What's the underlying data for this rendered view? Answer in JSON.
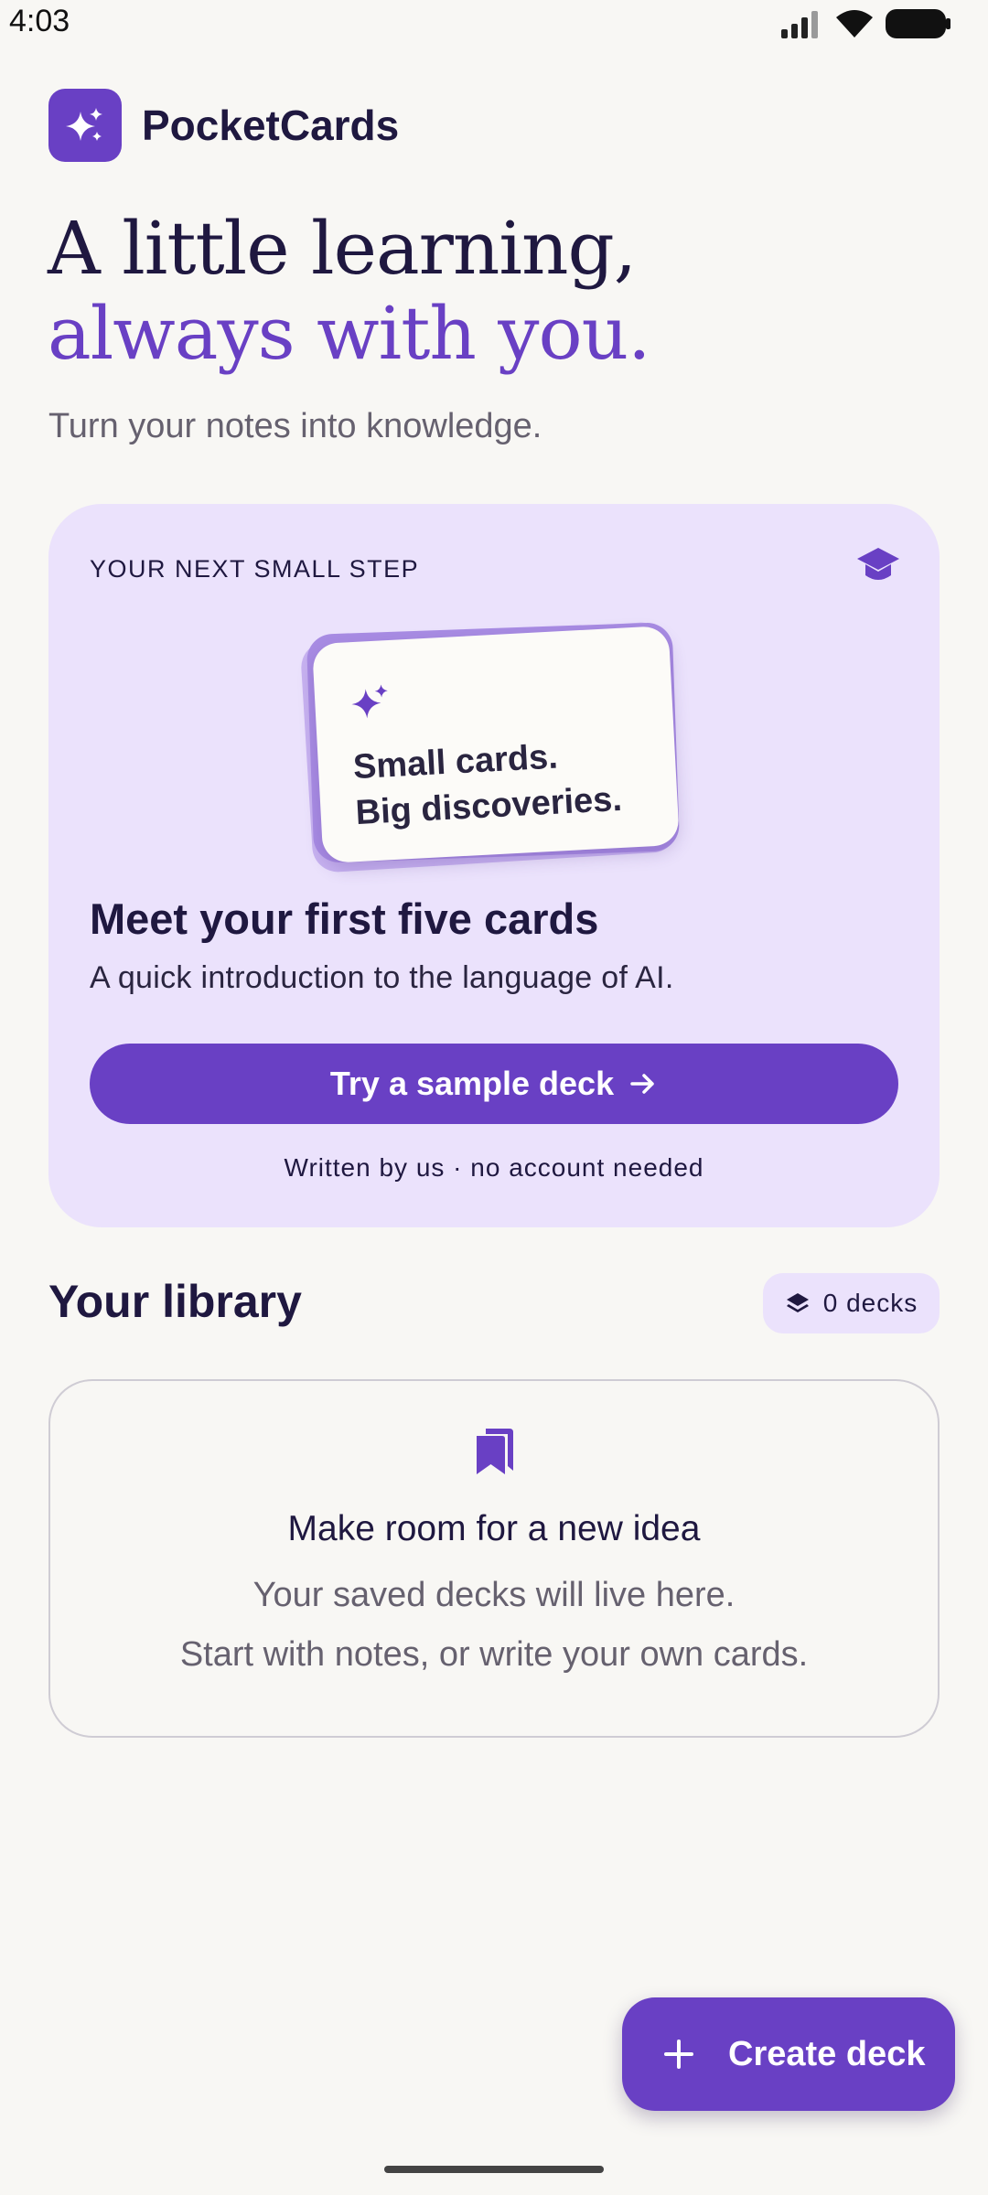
{
  "status_bar": {
    "time": "4:03"
  },
  "brand": {
    "name": "PocketCards",
    "logo_icon": "sparkle-icon"
  },
  "hero": {
    "line1": "A little learning,",
    "line2": "always with you.",
    "subtitle": "Turn your notes into knowledge."
  },
  "step_card": {
    "eyebrow": "YOUR NEXT SMALL STEP",
    "icon": "graduation-cap-icon",
    "card_line1": "Small cards.",
    "card_line2": "Big discoveries.",
    "title": "Meet your first five cards",
    "description": "A quick introduction to the language of AI.",
    "button_label": "Try a sample deck",
    "note": "Written by us · no account needed"
  },
  "library": {
    "title": "Your library",
    "deck_count": "0 decks",
    "empty_title": "Make room for a new idea",
    "empty_line1": "Your saved decks will live here.",
    "empty_line2": "Start with notes, or write your own cards."
  },
  "fab": {
    "label": "Create deck"
  },
  "colors": {
    "accent": "#6940c4",
    "card_bg": "#ebe2fc",
    "page_bg": "#f8f7f4",
    "text": "#1f1840",
    "muted": "#66616f"
  }
}
